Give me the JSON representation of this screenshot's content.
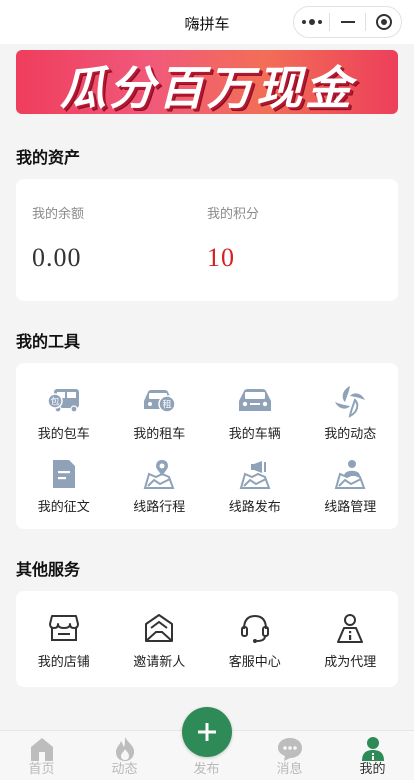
{
  "header": {
    "title": "嗨拼车",
    "capsule": {
      "menu_icon": "more-dots-icon",
      "minimize_icon": "minimize-icon",
      "close_icon": "close-circle-icon"
    }
  },
  "banner": {
    "text": "瓜分百万现金"
  },
  "assets": {
    "title": "我的资产",
    "balance_label": "我的余额",
    "balance_value": "0.00",
    "points_label": "我的积分",
    "points_value": "10",
    "points_color": "#d81e1e"
  },
  "tools": {
    "title": "我的工具",
    "items": [
      {
        "label": "我的包车",
        "icon": "charter-bus-icon"
      },
      {
        "label": "我的租车",
        "icon": "rental-car-icon"
      },
      {
        "label": "我的车辆",
        "icon": "car-icon"
      },
      {
        "label": "我的动态",
        "icon": "moments-icon"
      },
      {
        "label": "我的征文",
        "icon": "document-icon"
      },
      {
        "label": "线路行程",
        "icon": "route-map-icon"
      },
      {
        "label": "线路发布",
        "icon": "route-publish-icon"
      },
      {
        "label": "线路管理",
        "icon": "route-manage-icon"
      }
    ]
  },
  "services": {
    "title": "其他服务",
    "items": [
      {
        "label": "我的店铺",
        "icon": "shop-icon"
      },
      {
        "label": "邀请新人",
        "icon": "invite-mail-icon"
      },
      {
        "label": "客服中心",
        "icon": "headset-icon"
      },
      {
        "label": "成为代理",
        "icon": "agent-icon"
      }
    ]
  },
  "tabbar": {
    "items": [
      {
        "label": "首页",
        "icon": "home-icon"
      },
      {
        "label": "动态",
        "icon": "flame-icon"
      },
      {
        "label": "发布",
        "icon": "plus-icon"
      },
      {
        "label": "消息",
        "icon": "chat-icon"
      },
      {
        "label": "我的",
        "icon": "user-icon"
      }
    ],
    "active_index": 4,
    "accent": "#2e8b57"
  },
  "colors": {
    "tool_icon": "#8fa2b8",
    "service_icon": "#333333",
    "background": "#f4f4f4"
  }
}
